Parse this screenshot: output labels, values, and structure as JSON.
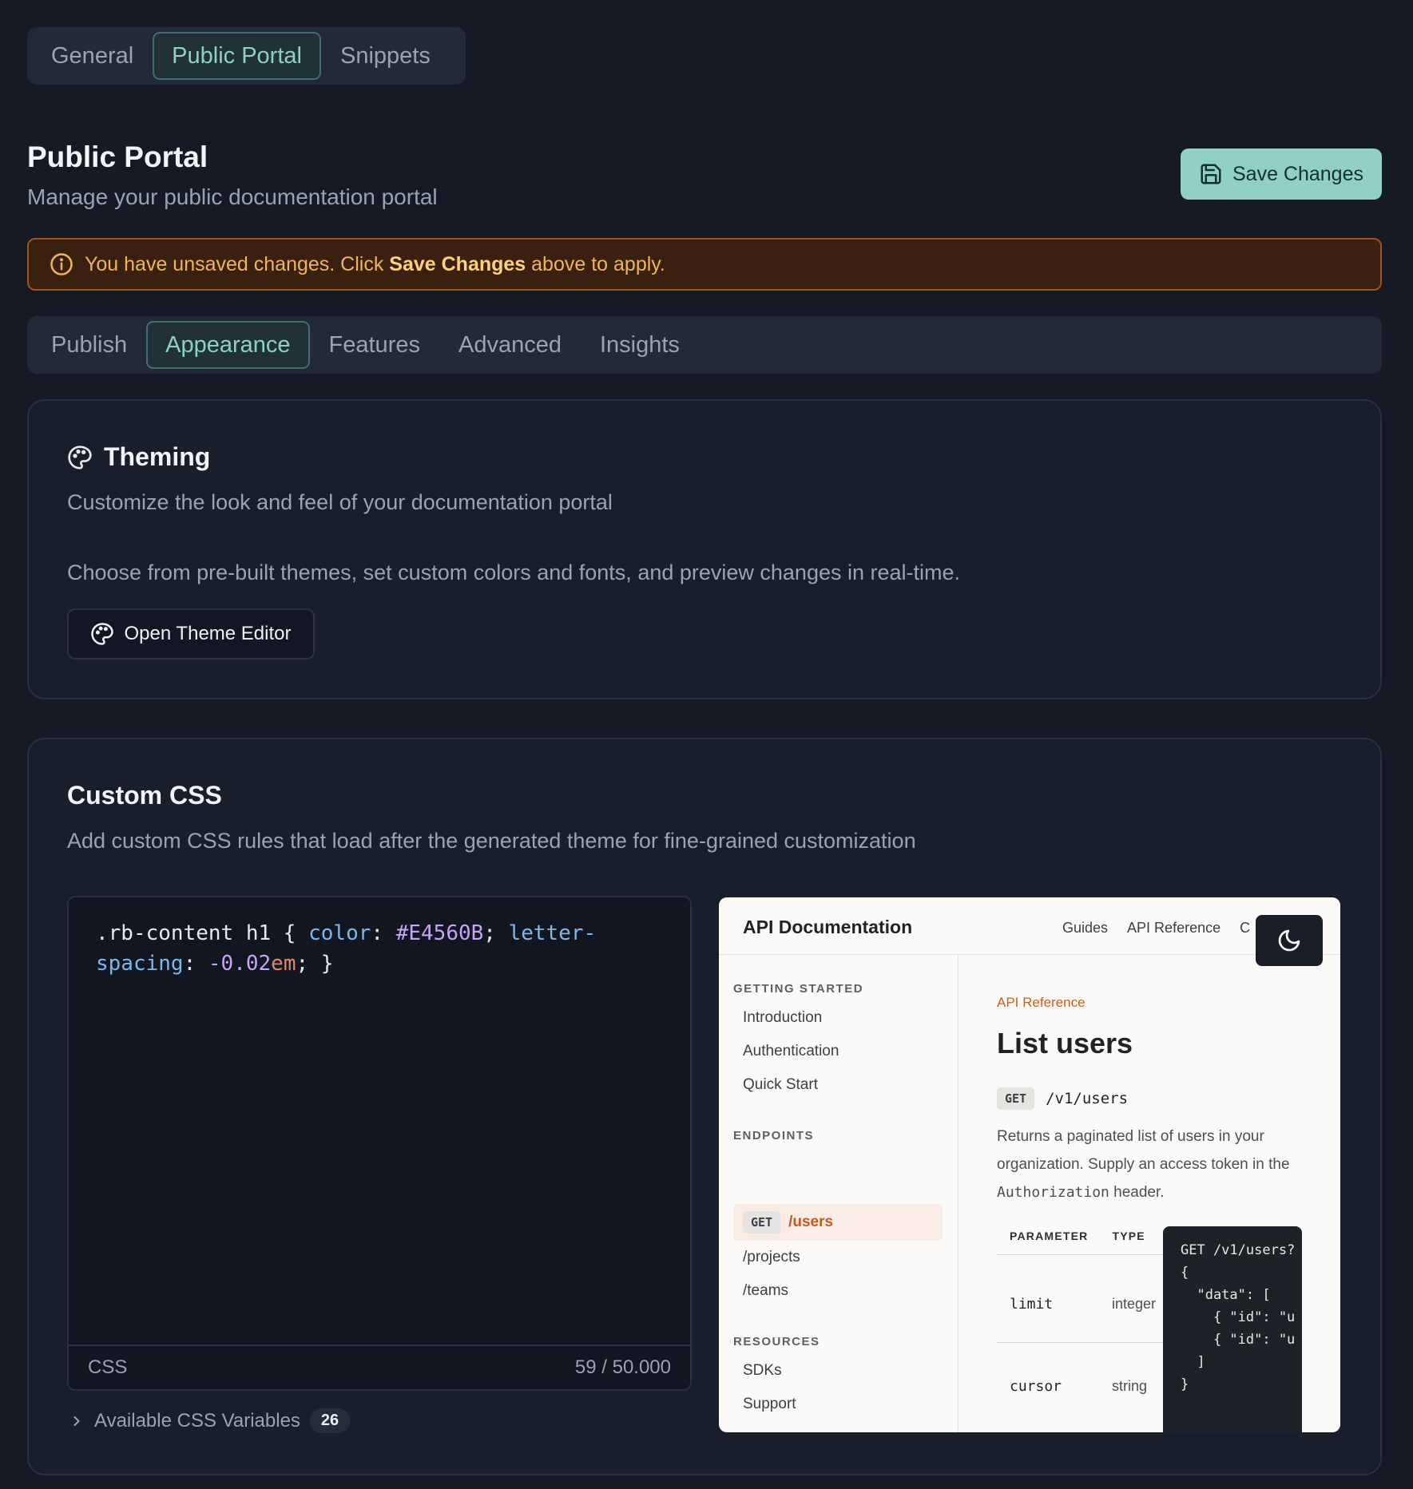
{
  "top_tabs": [
    "General",
    "Public Portal",
    "Snippets"
  ],
  "header": {
    "title": "Public Portal",
    "subtitle": "Manage your public documentation portal",
    "save_label": "Save Changes"
  },
  "banner": {
    "prefix": "You have unsaved changes. Click ",
    "emphasis": "Save Changes",
    "suffix": " above to apply."
  },
  "sub_tabs": [
    "Publish",
    "Appearance",
    "Features",
    "Advanced",
    "Insights"
  ],
  "theming": {
    "title": "Theming",
    "description": "Customize the look and feel of your documentation portal",
    "body": "Choose from pre-built themes, set custom colors and fonts, and preview changes in real-time.",
    "button_label": "Open Theme Editor"
  },
  "custom_css": {
    "title": "Custom CSS",
    "description": "Add custom CSS rules that load after the generated theme for fine-grained customization",
    "code": {
      "selector": ".rb-content h1 { ",
      "prop1": "color",
      "sep1": ": ",
      "val1": "#E4560B",
      "sep2": "; ",
      "prop2": "letter-spacing",
      "sep3": ": ",
      "val2": "-0.02",
      "unit": "em",
      "end": "; }"
    },
    "language": "CSS",
    "char_count": "59 / 50.000",
    "vars_label": "Available CSS Variables",
    "vars_count": "26"
  },
  "preview": {
    "brand": "API Documentation",
    "nav": [
      "Guides",
      "API Reference",
      "C"
    ],
    "sections": {
      "getting_started": "GETTING STARTED",
      "endpoints": "ENDPOINTS",
      "resources": "RESOURCES"
    },
    "getting_started_items": [
      "Introduction",
      "Authentication",
      "Quick Start"
    ],
    "endpoint_active_method": "GET",
    "endpoint_active_path": "/users",
    "endpoint_items": [
      "/projects",
      "/teams"
    ],
    "resource_items": [
      "SDKs",
      "Support"
    ],
    "crumb": "API Reference",
    "heading": "List users",
    "method": "GET",
    "path": "/v1/users",
    "desc_part1": "Returns a paginated list of users in your organization. Supply an access token in the ",
    "desc_code": "Authorization",
    "desc_part2": " header.",
    "table_headers": [
      "PARAMETER",
      "TYPE"
    ],
    "params": [
      {
        "name": "limit",
        "type": "integer"
      },
      {
        "name": "cursor",
        "type": "string"
      }
    ],
    "code_lines": [
      "GET /v1/users?",
      "",
      "{",
      "  \"data\": [",
      "    { \"id\": \"u",
      "    { \"id\": \"u",
      "  ]",
      "}"
    ]
  }
}
